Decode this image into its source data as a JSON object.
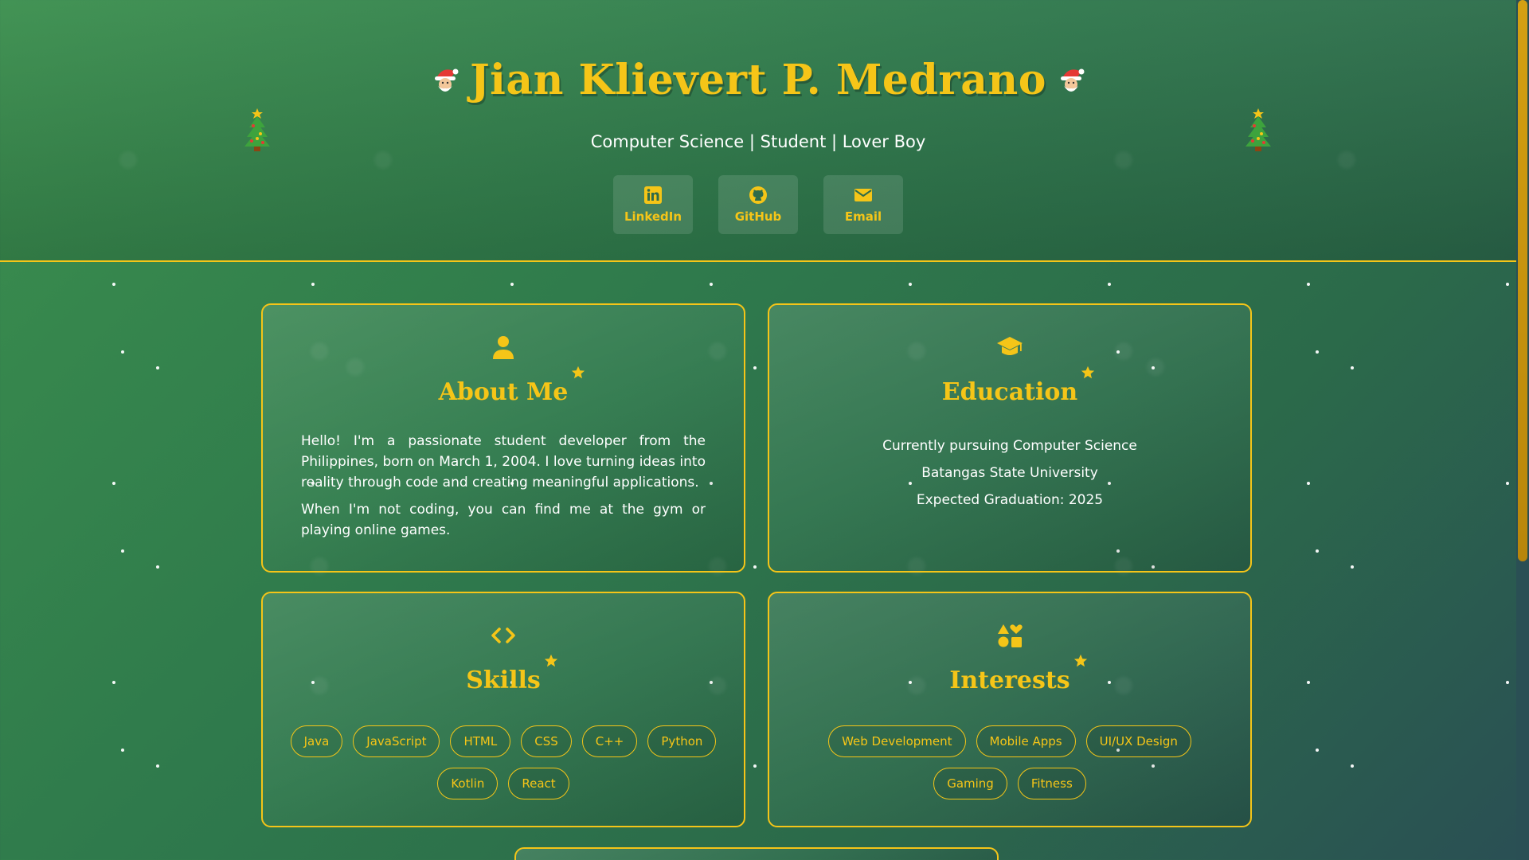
{
  "header": {
    "name": "Jian Klievert P. Medrano",
    "subtitle": "Computer Science | Student | Lover Boy",
    "social": [
      {
        "label": "LinkedIn",
        "icon": "linkedin-icon"
      },
      {
        "label": "GitHub",
        "icon": "github-icon"
      },
      {
        "label": "Email",
        "icon": "envelope-icon"
      }
    ]
  },
  "about": {
    "title": "About Me",
    "icon": "user-icon",
    "paragraphs": [
      "Hello! I'm a passionate student developer from the Philippines, born on March 1, 2004. I love turning ideas into reality through code and creating meaningful applications.",
      "When I'm not coding, you can find me at the gym or playing online games."
    ]
  },
  "education": {
    "title": "Education",
    "icon": "graduation-cap-icon",
    "lines": [
      "Currently pursuing Computer Science",
      "Batangas State University",
      "Expected Graduation: 2025"
    ]
  },
  "skills": {
    "title": "Skills",
    "icon": "code-icon",
    "items": [
      "Java",
      "JavaScript",
      "HTML",
      "CSS",
      "C++",
      "Python",
      "Kotlin",
      "React"
    ]
  },
  "interests": {
    "title": "Interests",
    "icon": "shapes-icon",
    "items": [
      "Web Development",
      "Mobile Apps",
      "UI/UX Design",
      "Gaming",
      "Fitness"
    ]
  },
  "colors": {
    "accent": "#f5c518",
    "background": "#2f7a4c",
    "text": "#ffffff"
  }
}
